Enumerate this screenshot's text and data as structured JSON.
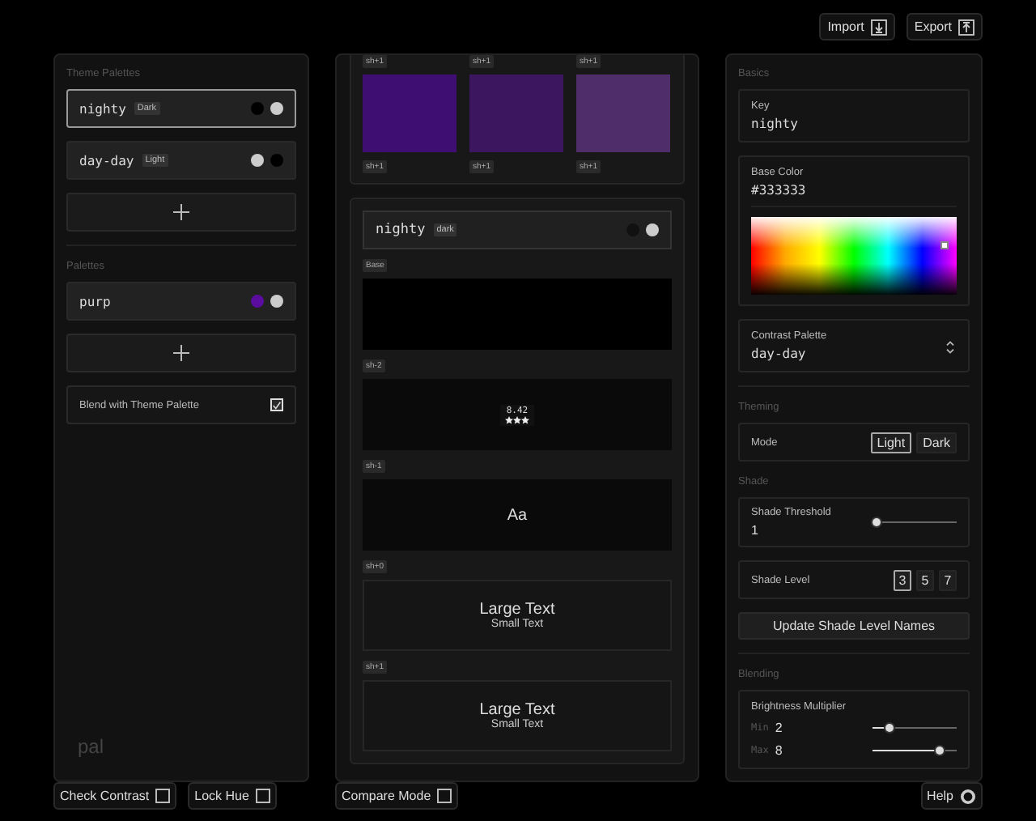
{
  "toolbar": {
    "buttons": [
      {
        "label": "Import",
        "kind": "import"
      },
      {
        "label": "Export",
        "kind": "export"
      }
    ]
  },
  "sidebar": {
    "theme_palettes": {
      "title": "Theme Palettes",
      "items": [
        {
          "name": "nighty",
          "badge": "Dark",
          "selected": true,
          "dots": [
            {
              "color": "#000000"
            },
            {
              "color": "#cccccc"
            }
          ]
        },
        {
          "name": "day-day",
          "badge": "Light",
          "selected": false,
          "dots": [
            {
              "color": "#cccccc"
            },
            {
              "color": "#000000"
            }
          ]
        }
      ]
    },
    "palettes": {
      "title": "Palettes",
      "items": [
        {
          "name": "purp",
          "selected": false,
          "dots": [
            {
              "color": "#5a0d9e"
            },
            {
              "color": "#cccccc"
            }
          ]
        }
      ]
    },
    "blend": {
      "label": "Blend with Theme Palette",
      "checked": true
    },
    "logo": "pal"
  },
  "preview": {
    "top_tags": [
      "sh+1",
      "sh+1",
      "sh+1"
    ],
    "swatches": [
      {
        "color": "#3e0e72",
        "label": "sh+1"
      },
      {
        "color": "#3c175f",
        "label": "sh+1"
      },
      {
        "color": "#4e2d6a",
        "label": "sh+1"
      }
    ],
    "theme": {
      "name": "nighty",
      "badge": "dark",
      "dots": [
        {
          "color": "#111111"
        },
        {
          "color": "#cccccc"
        }
      ]
    },
    "blocks": [
      {
        "tag": "Base",
        "kind": "empty"
      },
      {
        "tag": "sh-2",
        "kind": "score",
        "value": "8.42",
        "stars": 3
      },
      {
        "tag": "sh-1",
        "kind": "sample",
        "text": "Aa"
      },
      {
        "tag": "sh+0",
        "kind": "text",
        "large": "Large Text",
        "small": "Small Text"
      },
      {
        "tag": "sh+1",
        "kind": "text",
        "large": "Large Text",
        "small": "Small Text"
      }
    ]
  },
  "settings": {
    "basics": {
      "title": "Basics",
      "key_label": "Key",
      "key": "nighty",
      "base_label": "Base Color",
      "base_color": "#333333",
      "contrast_label": "Contrast Palette",
      "contrast": "day-day"
    },
    "theming": {
      "title": "Theming",
      "mode_label": "Mode",
      "modes": [
        {
          "label": "Light",
          "selected": true
        },
        {
          "label": "Dark",
          "selected": false
        }
      ]
    },
    "shade": {
      "title": "Shade",
      "threshold_label": "Shade Threshold",
      "threshold": "1",
      "threshold_slider": {
        "level": 0.05
      },
      "level_label": "Shade Level",
      "levels": [
        {
          "label": "3",
          "selected": true
        },
        {
          "label": "5",
          "selected": false
        },
        {
          "label": "7",
          "selected": false
        }
      ],
      "update_button": "Update Shade Level Names"
    },
    "blending": {
      "title": "Blending",
      "label": "Brightness Multiplier",
      "rows": [
        {
          "name": "Min",
          "value": "2",
          "level": 0.22
        },
        {
          "name": "Max",
          "value": "8",
          "level": 0.8
        }
      ]
    }
  },
  "footer": {
    "left": [
      {
        "label": "Check Contrast",
        "checked": false
      },
      {
        "label": "Lock Hue",
        "checked": false
      }
    ],
    "middle": [
      {
        "label": "Compare Mode",
        "checked": false
      }
    ],
    "help": "Help"
  }
}
